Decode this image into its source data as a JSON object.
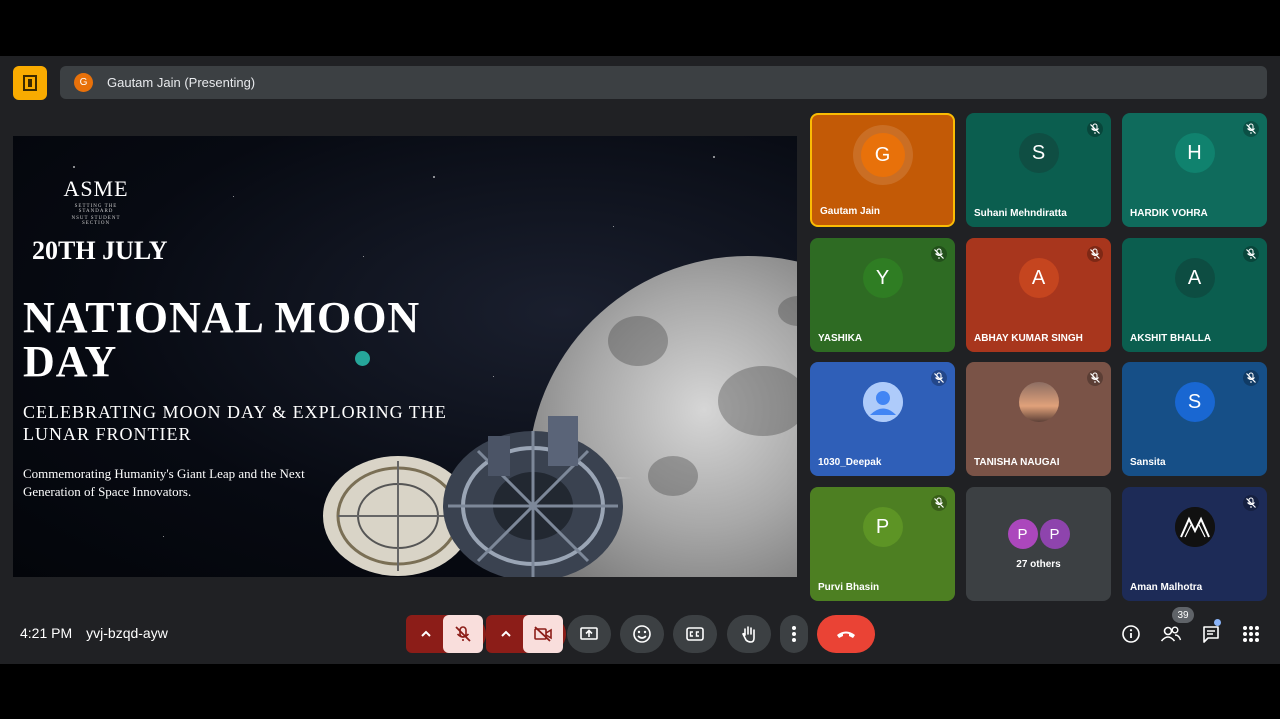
{
  "presenter": {
    "initial": "G",
    "label": "Gautam Jain (Presenting)"
  },
  "slide": {
    "logo_word": "ASME",
    "logo_sub_1": "SETTING THE STANDARD",
    "logo_sub_2": "NSUT STUDENT SECTION",
    "date": "20TH JULY",
    "title": "NATIONAL MOON DAY",
    "subtitle": "CELEBRATING MOON DAY & EXPLORING THE LUNAR FRONTIER",
    "description": "Commemorating Humanity's Giant Leap and the Next Generation of Space Innovators."
  },
  "participants": [
    {
      "name": "Gautam Jain",
      "initial": "G",
      "bg": "#c35a06",
      "avatar_bg": "#e8710a",
      "muted": false
    },
    {
      "name": "Suhani Mehndiratta",
      "initial": "S",
      "bg": "#0b5e4f",
      "avatar_bg": "#0f4e43",
      "muted": true
    },
    {
      "name": "HARDIK VOHRA",
      "initial": "H",
      "bg": "#0f6b5c",
      "avatar_bg": "#10826e",
      "muted": true
    },
    {
      "name": "YASHIKA",
      "initial": "Y",
      "bg": "#2e6b23",
      "avatar_bg": "#2f7d23",
      "muted": true
    },
    {
      "name": "ABHAY KUMAR SINGH",
      "initial": "A",
      "bg": "#a8361d",
      "avatar_bg": "#c5451f",
      "muted": true
    },
    {
      "name": "AKSHIT BHALLA",
      "initial": "A",
      "bg": "#0b5e4f",
      "avatar_bg": "#0d4d42",
      "muted": true
    },
    {
      "name": "1030_Deepak",
      "initial": "",
      "bg": "#2f5fb8",
      "avatar_bg": "#8ab4f8",
      "muted": true
    },
    {
      "name": "TANISHA NAUGAI",
      "initial": "",
      "bg": "#7a5347",
      "avatar_bg": "#b57d62",
      "muted": true
    },
    {
      "name": "Sansita",
      "initial": "S",
      "bg": "#164f87",
      "avatar_bg": "#1967d2",
      "muted": true
    },
    {
      "name": "Purvi Bhasin",
      "initial": "P",
      "bg": "#4d7f22",
      "avatar_bg": "#5d9425",
      "muted": true
    },
    {
      "name": "27 others",
      "initial": "P",
      "bg": "#3c4043",
      "avatar_bg": "#9c27b0",
      "muted": false
    },
    {
      "name": "Aman Malhotra",
      "initial": "",
      "bg": "#1d2b57",
      "avatar_bg": "#111111",
      "muted": true
    }
  ],
  "bottom": {
    "time": "4:21 PM",
    "meeting_code": "yvj-bzqd-ayw",
    "people_count": "39"
  }
}
